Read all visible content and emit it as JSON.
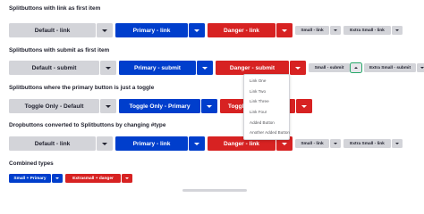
{
  "sections": {
    "link": {
      "heading": "Splitbuttons with link as first item",
      "default": "Default - link",
      "primary": "Primary - link",
      "danger": "Danger - link",
      "small": "Small - link",
      "extra_small": "Extra Small - link"
    },
    "submit": {
      "heading": "Splitbuttons with submit as first item",
      "default": "Default - submit",
      "primary": "Primary - submit",
      "danger": "Danger - submit",
      "small": "Small - submit",
      "extra_small": "Extra Small - submit"
    },
    "toggle": {
      "heading": "Splitbuttons where the primary button is just a toggle",
      "default": "Toggle Only - Default",
      "primary": "Toggle Only - Primary",
      "danger": "Toggle Only - Danger"
    },
    "dropbuttons": {
      "heading": "Dropbuttons converted to Splitbuttons by changing #type",
      "default": "Default - link",
      "primary": "Primary - link",
      "danger": "Danger - link",
      "small": "Small - link",
      "extra_small": "Extra Small - link"
    },
    "combined": {
      "heading": "Combined types",
      "small_primary": "Small + Primary",
      "extrasmall_danger": "Extrasmall + danger"
    }
  },
  "dropdown": {
    "items": [
      "Link One",
      "Link Two",
      "Link Three",
      "Link Four",
      "Added Button",
      "Another Added Button"
    ]
  },
  "colors": {
    "default": "#d3d4d9",
    "primary": "#003ecc",
    "danger": "#d72222",
    "focus_outline": "#26a769"
  }
}
